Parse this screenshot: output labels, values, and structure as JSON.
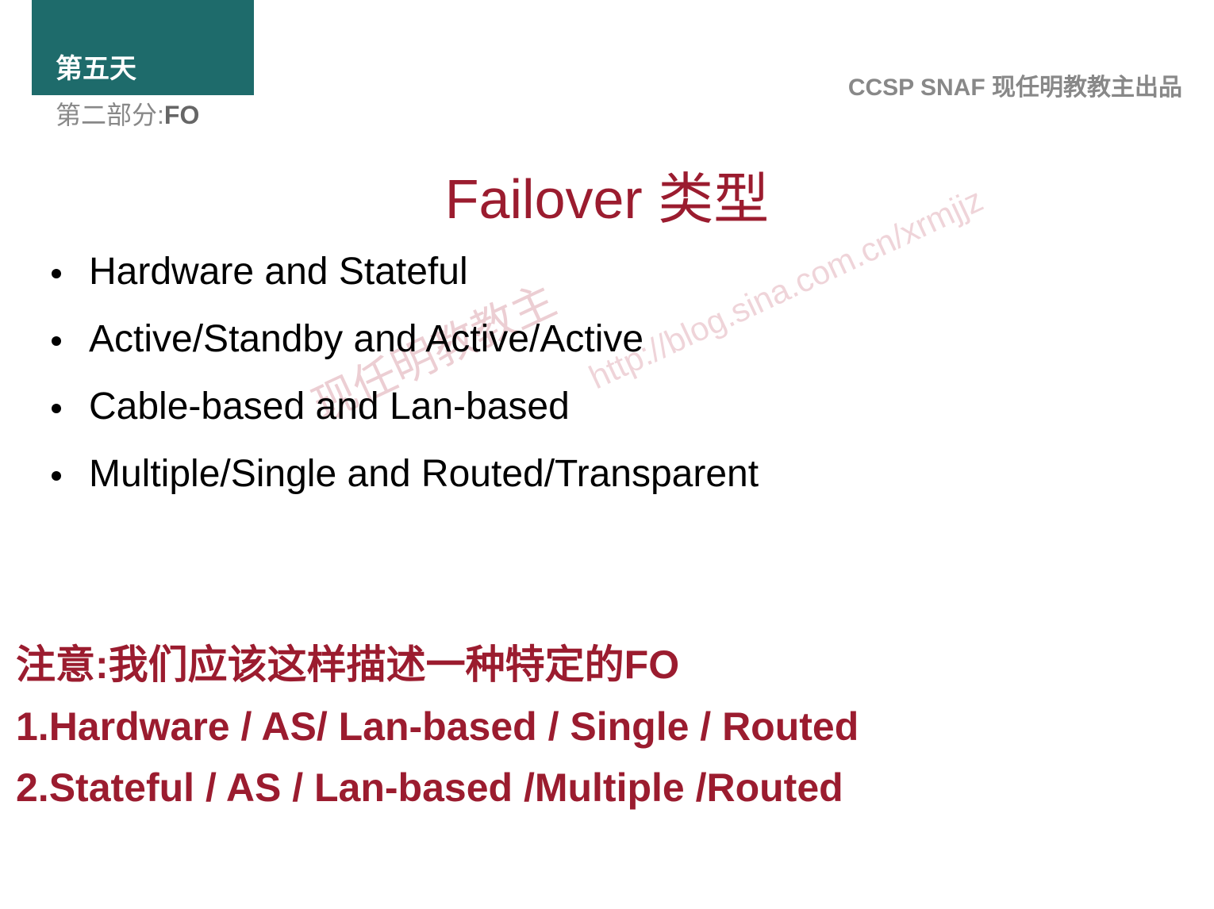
{
  "header": {
    "day": "第五天",
    "subtitle_prefix": "第二部分:",
    "subtitle_bold": "FO",
    "right_text": "CCSP SNAF  现任明教教主出品"
  },
  "title": "Failover 类型",
  "bullets": [
    "Hardware and Stateful",
    "Active/Standby and Active/Active",
    "Cable-based and Lan-based",
    "Multiple/Single and Routed/Transparent"
  ],
  "note": {
    "line1": "注意:我们应该这样描述一种特定的FO",
    "line2": "1.Hardware / AS/ Lan-based / Single / Routed",
    "line3": "2.Stateful / AS / Lan-based /Multiple /Routed"
  },
  "watermark": {
    "main": "现任明教教主",
    "url": "http://blog.sina.com.cn/xrmjjz"
  }
}
